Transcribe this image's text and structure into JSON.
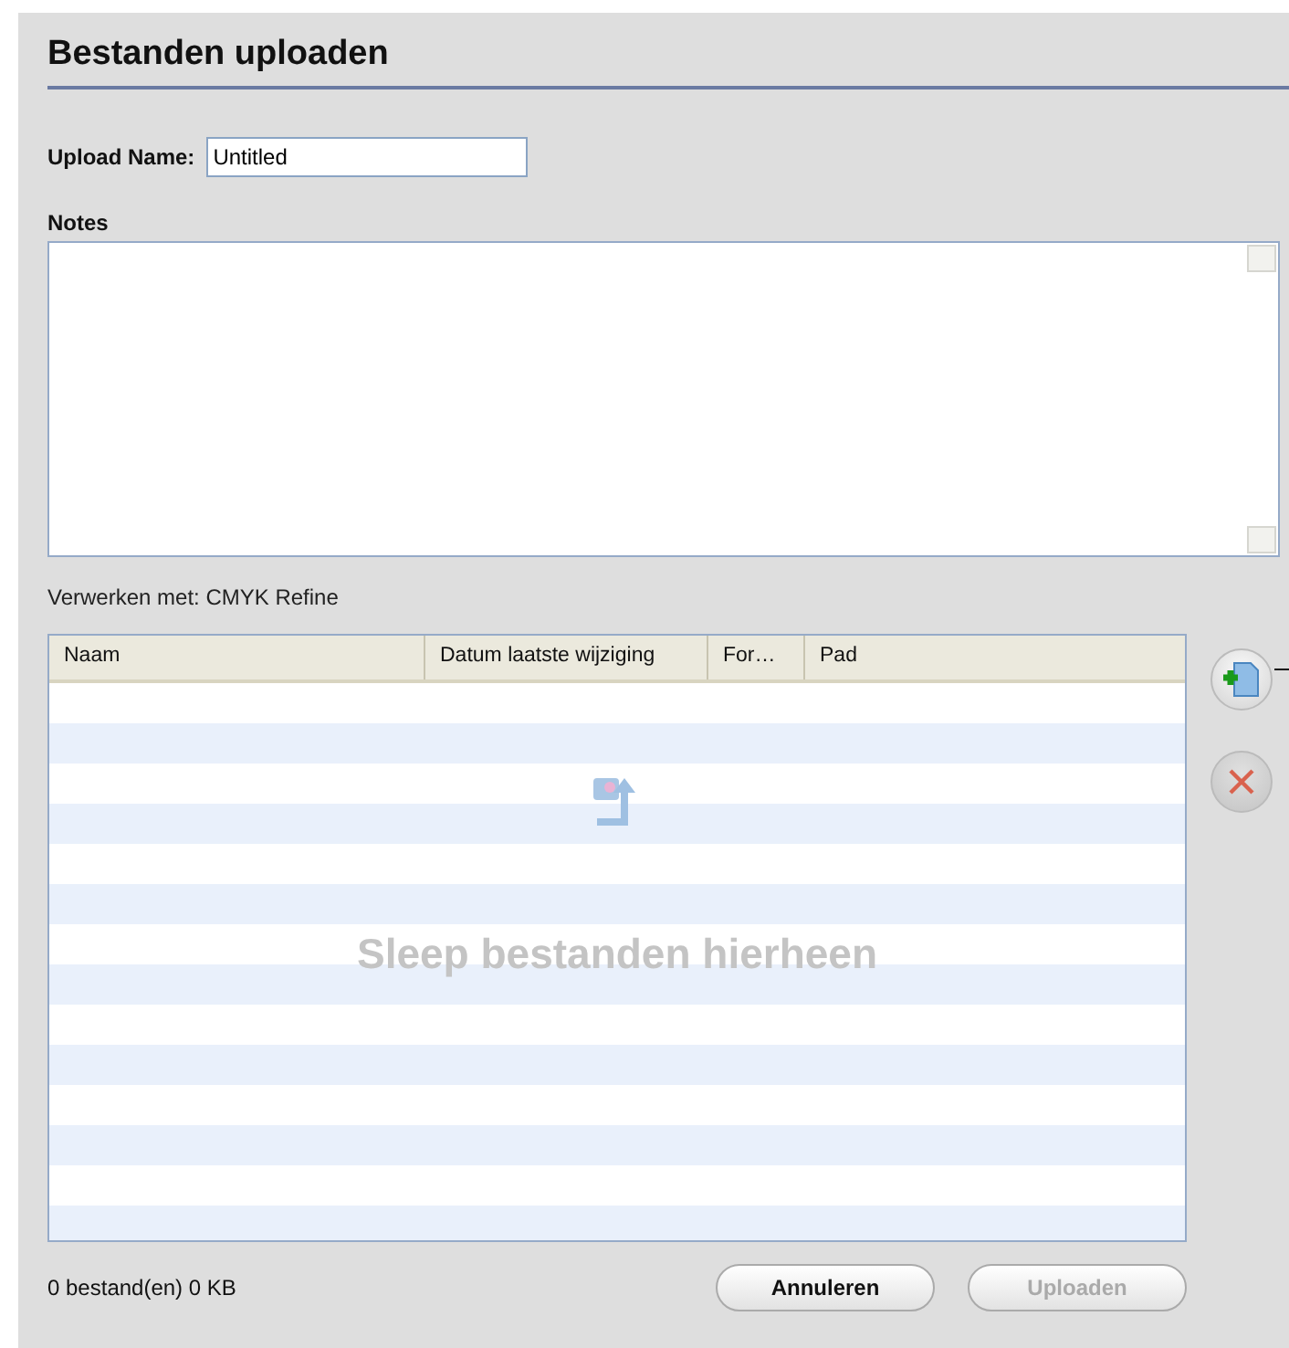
{
  "title": "Bestanden uploaden",
  "upload_name": {
    "label": "Upload Name:",
    "value": "Untitled"
  },
  "notes": {
    "label": "Notes"
  },
  "process_with": "Verwerken met: CMYK Refine",
  "table": {
    "columns": [
      "Naam",
      "Datum laatste wijziging",
      "For…",
      "Pad"
    ],
    "drop_hint": "Sleep bestanden hierheen"
  },
  "side_buttons": [
    {
      "kind": "add"
    },
    {
      "kind": "remove"
    }
  ],
  "status": "0 bestand(en) 0 KB",
  "buttons": [
    {
      "label": "Annuleren",
      "disabled": false
    },
    {
      "label": "Uploaden",
      "disabled": true
    }
  ]
}
